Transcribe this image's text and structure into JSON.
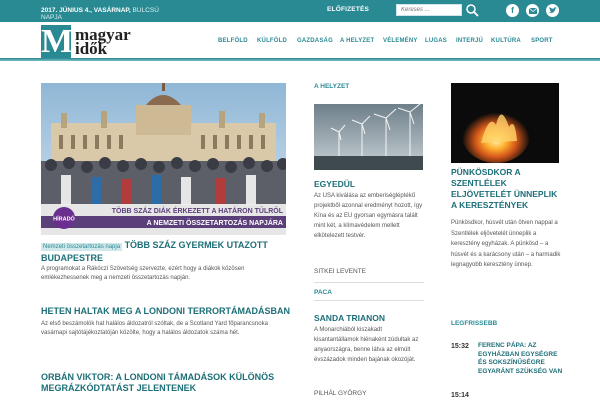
{
  "topbar": {
    "date_bold": "2017. JÚNIUS 4., VASÁRNAP,",
    "date_rest": "BULCSÚ NAPJA",
    "subscribe": "ELŐFIZETÉS",
    "search_placeholder": "Keresés ..."
  },
  "logo": {
    "mark": "M",
    "line1": "magyar",
    "line2": "idők"
  },
  "nav": [
    "BELFÖLD",
    "KÜLFÖLD",
    "GAZDASÁG",
    "A HELYZET",
    "VÉLEMÉNY",
    "LUGAS",
    "INTERJÚ",
    "KULTÚRA",
    "SPORT"
  ],
  "hero": {
    "overlay_line1": "TÖBB SZÁZ DIÁK ÉRKEZETT A HATÁRON TÚLRÓL",
    "overlay_line2": "A NEMZETI ÖSSZETARTOZÁS NAPJÁRA",
    "badge": "HÍRADÓ",
    "tag": "Nemzeti összetartozás napja",
    "title": "Több száz gyermek utazott Budapestre",
    "excerpt": "A programokat a Rákóczi Szövetség szervezte, ezért hogy a diákok közösen emlékezhessenek meg a nemzeti összetartozás napján."
  },
  "articles": [
    {
      "title": "HETEN HALTAK MEG A LONDONI TERRORTÁMADÁSBAN",
      "excerpt": "Az első beszámolók hat halálos áldozatról szóltak, de a Scotland Yard főparancsnoka vasárnapi sajtótájékoztatóján közölte, hogy a halálos áldozatok száma hét."
    },
    {
      "title": "ORBÁN VIKTOR: A LONDONI TÁMADÁSOK KÜLÖNÖS MEGRÁZKÓDTATÁST JELENTENEK",
      "excerpt": ""
    }
  ],
  "helyzet": {
    "section": "A HELYZET",
    "title": "EGYEDÜL",
    "text": "Az USA kiválása az emberiségléptékű projektből azonnal eredményt hozott, így Kína és az EU gyorsan egymásra talált mint két, a klímavédelem mellett elkötelezett testvér.",
    "author": "SITKEI LEVENTE"
  },
  "paca": {
    "section": "PACA",
    "title": "SANDA TRIANON",
    "text": "A Monarchiából kiszakadt kisantantállamok hiénaként zúdultak az anyaországra, benne látva az elmúlt évszázadok minden bajának okozóját.",
    "author": "PILHÁL GYÖRGY"
  },
  "feature": {
    "title": "PÜNKÖSDKOR A SZENTLÉLEK ELJÖVETELÉT ÜNNEPLIK A KERESZTÉNYEK",
    "text": "Pünkösdkor, húsvét után ötven nappal a Szentlélek eljövetelét ünneplik a keresztény egyházak. A pünkösd – a húsvét és a karácsony után – a harmadik legnagyobb keresztény ünnep."
  },
  "latest": {
    "section": "LEGFRISSEBB",
    "items": [
      {
        "time": "15:32",
        "text": "FERENC PÁPA: AZ EGYHÁZBAN EGYSÉGRE ÉS SOKSZÍNŰSÉGRE EGYARÁNT SZÜKSÉG VAN"
      },
      {
        "time": "15:14",
        "text": ""
      }
    ]
  },
  "colors": {
    "accent": "#2a8a94",
    "headline": "#1d6f78"
  },
  "icons": [
    "search-icon",
    "facebook-icon",
    "email-icon",
    "twitter-icon"
  ]
}
